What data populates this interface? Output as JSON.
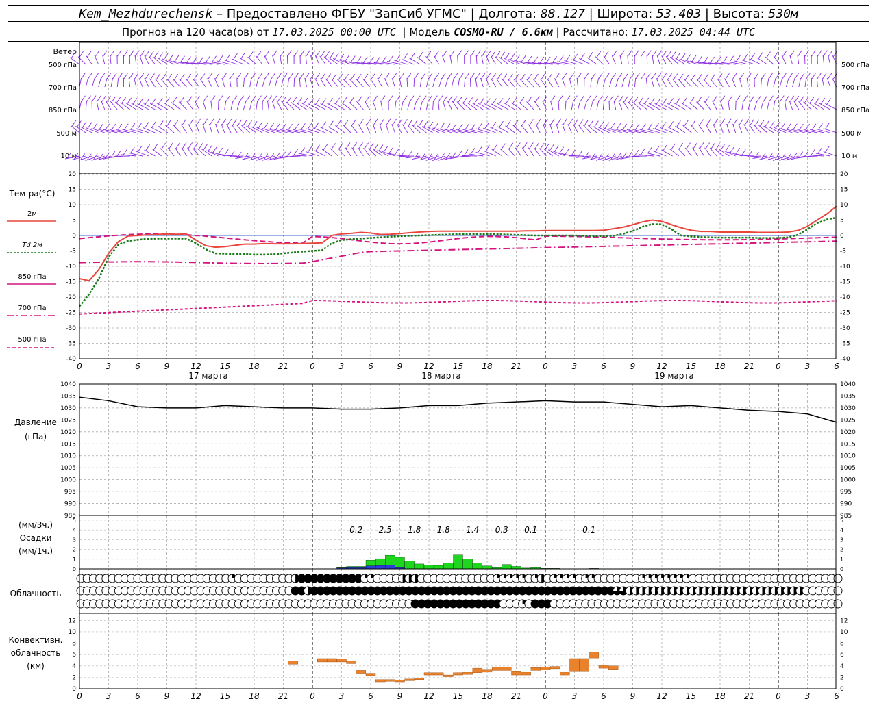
{
  "header": {
    "station": "Kem_Mezhdurechensk",
    "provided_by": "– Предоставлено ФГБУ \"ЗапСиб УГМС\"",
    "lon_label": "Долгота:",
    "lon_value": "88.127",
    "lat_label": "Широта:",
    "lat_value": "53.403",
    "alt_label": "Высота:",
    "alt_value": "530м",
    "forecast_label": "Прогноз на 120 часа(ов) от",
    "forecast_start": "17.03.2025 00:00 UTC",
    "model_label": "Модель",
    "model_value": "COSMO-RU / 6.6км",
    "calc_label": "Рассчитано:",
    "calc_value": "17.03.2025 04:44 UTC"
  },
  "labels": {
    "wind": "Ветер",
    "wind_levels": [
      "500 гПа",
      "700 гПа",
      "850 гПа",
      "500 м",
      "10  м"
    ],
    "temp_title": "Тем-ра(°C)",
    "legend_2m": "2м",
    "legend_td": "Td  2м",
    "legend_850": "850 гПа",
    "legend_700": "700 гПа",
    "legend_500": "500 гПа",
    "pressure_title": "Давление",
    "pressure_unit": "(гПа)",
    "precip_unit3": "(мм/3ч.)",
    "precip_title": "Осадки",
    "precip_unit1": "(мм/1ч.)",
    "cloud_title": "Облачность",
    "conv_title1": "Конвективн.",
    "conv_title2": "облачность",
    "conv_unit": "(км)",
    "days": [
      "17 марта",
      "18 марта",
      "19 марта"
    ]
  },
  "colors": {
    "wind": "#8b2be2",
    "t2m": "#e8463c",
    "td2m": "#1a7a1a",
    "t850": "#d4147f",
    "pressure": "#000000",
    "precip_rain": "#1fd61f",
    "precip_snow": "#2a3fd0",
    "convective": "#e8822c"
  },
  "chart_data": [
    {
      "type": "line",
      "title": "Тем-ра(°C)",
      "x_hours": [
        0,
        1,
        2,
        3,
        4,
        5,
        6,
        7,
        8,
        9,
        10,
        11,
        12,
        13,
        14,
        15,
        16,
        17,
        18,
        19,
        20,
        21,
        22,
        23,
        24,
        25,
        26,
        27,
        28,
        29,
        30,
        31,
        32,
        33,
        34,
        35,
        36,
        37,
        38,
        39,
        40,
        41,
        42,
        43,
        44,
        45,
        46,
        47,
        48,
        49,
        50,
        51,
        52,
        53,
        54,
        55,
        56,
        57,
        58,
        59,
        60,
        61,
        62,
        63,
        64,
        65,
        66,
        67,
        68,
        69,
        70,
        71,
        72,
        73,
        74,
        75,
        76,
        77,
        78
      ],
      "ylim": [
        -40,
        20
      ],
      "yticks": [
        -40,
        -35,
        -30,
        -25,
        -20,
        -15,
        -10,
        -5,
        0,
        5,
        10,
        15,
        20
      ],
      "series": [
        {
          "name": "2м",
          "values": [
            -14,
            -14.7,
            -11,
            -5.8,
            -2,
            -0.2,
            0,
            0.2,
            0.3,
            0.5,
            0.4,
            0.5,
            -1.5,
            -3.3,
            -3.8,
            -3.6,
            -3.2,
            -2.8,
            -2.8,
            -2.6,
            -2.7,
            -2.7,
            -2.7,
            -2.6,
            -2.5,
            -2.4,
            0,
            0.5,
            0.7,
            1,
            0.8,
            0.3,
            0.4,
            0.6,
            0.9,
            1.1,
            1.3,
            1.4,
            1.4,
            1.4,
            1.4,
            1.4,
            1.4,
            1.4,
            1.4,
            1.4,
            1.5,
            1.5,
            1.6,
            1.6,
            1.6,
            1.6,
            1.6,
            1.6,
            1.7,
            2.2,
            2.7,
            3.5,
            4.4,
            5,
            4.6,
            3.5,
            2.5,
            1.7,
            1.3,
            1.3,
            1.1,
            1.1,
            1.1,
            1.1,
            1,
            1,
            1,
            1.1,
            1.6,
            3,
            5,
            7,
            9.5
          ]
        },
        {
          "name": "Td 2м",
          "values": [
            -23,
            -19,
            -14,
            -7,
            -3,
            -1.8,
            -1.4,
            -1.1,
            -1,
            -1,
            -1,
            -1,
            -2.5,
            -4.5,
            -5.8,
            -5.9,
            -6,
            -6,
            -6.2,
            -6.2,
            -6.1,
            -5.8,
            -5.5,
            -5.2,
            -5,
            -4.8,
            -2.5,
            -1.5,
            -1.2,
            -1,
            -0.8,
            -0.6,
            -0.4,
            -0.2,
            -0.1,
            0,
            0.1,
            0.2,
            0.3,
            0.4,
            0.5,
            0.5,
            0.5,
            0.4,
            0.3,
            0.2,
            0.1,
            0,
            0,
            0,
            0,
            0,
            -0.1,
            -0.2,
            -0.2,
            -0.1,
            0.5,
            1.5,
            2.8,
            3.7,
            3.6,
            2,
            0,
            -0.3,
            -0.5,
            -0.6,
            -0.7,
            -0.7,
            -0.7,
            -0.7,
            -0.8,
            -0.8,
            -0.8,
            -0.6,
            0.2,
            2,
            4,
            5.2,
            5.8
          ]
        }
      ]
    },
    {
      "type": "line",
      "title": "Давление",
      "ylabel": "(гПа)",
      "ylim": [
        985,
        1040
      ],
      "yticks": [
        985,
        990,
        995,
        1000,
        1005,
        1010,
        1015,
        1020,
        1025,
        1030,
        1035,
        1040
      ],
      "x_hours": [
        0,
        3,
        6,
        9,
        12,
        15,
        18,
        21,
        24,
        27,
        30,
        33,
        36,
        39,
        42,
        45,
        48,
        51,
        54,
        57,
        60,
        63,
        66,
        69,
        72,
        75,
        78
      ],
      "series": [
        {
          "name": "",
          "values": [
            1034.5,
            1033,
            1030.5,
            1030,
            1030,
            1031,
            1030.5,
            1030,
            1030,
            1029.5,
            1029.5,
            1030,
            1031,
            1031,
            1032,
            1032.5,
            1033,
            1032.5,
            1032.5,
            1031.5,
            1030.5,
            1031,
            1030,
            1029,
            1028.5,
            1027.5,
            1024
          ]
        }
      ]
    },
    {
      "type": "bar",
      "title": "Осадки",
      "ylabel": "(мм/1ч.)",
      "ylim": [
        0,
        5
      ],
      "x_hours": [
        27,
        28,
        29,
        30,
        31,
        32,
        33,
        34,
        35,
        36,
        37,
        38,
        39,
        40,
        41,
        42,
        43,
        44,
        45,
        46,
        47,
        48,
        49,
        50,
        51,
        52,
        53,
        54
      ],
      "series": [
        {
          "name": "rain",
          "values": [
            0.05,
            0.05,
            0.05,
            0.6,
            0.7,
            1,
            1,
            0.8,
            0.5,
            0.4,
            0.35,
            0.6,
            1.5,
            1,
            0.6,
            0.3,
            0.2,
            0.45,
            0.25,
            0.15,
            0.2,
            0.05,
            0.05,
            0,
            0,
            0,
            0.05,
            0
          ]
        },
        {
          "name": "snow",
          "values": [
            0.15,
            0.2,
            0.2,
            0.3,
            0.35,
            0.4,
            0.2,
            0,
            0,
            0,
            0,
            0,
            0,
            0,
            0,
            0,
            0,
            0,
            0,
            0,
            0,
            0,
            0,
            0,
            0,
            0,
            0,
            0
          ]
        }
      ],
      "totals_3h": [
        "0.2",
        "2.5",
        "1.8",
        "1.8",
        "1.4",
        "0.3",
        "0.1",
        "",
        "0.1"
      ]
    },
    {
      "type": "bar",
      "title": "Конвективн. облачность",
      "ylabel": "(км)",
      "ylim": [
        0,
        13
      ],
      "yticks": [
        0,
        2,
        4,
        6,
        8,
        10,
        12
      ],
      "x_hours": [
        22,
        25,
        26,
        27,
        28,
        29,
        30,
        31,
        32,
        33,
        34,
        35,
        36,
        37,
        38,
        39,
        40,
        41,
        42,
        43,
        44,
        45,
        46,
        47,
        48,
        49,
        50,
        51,
        52,
        53,
        54,
        55
      ],
      "bases_km": [
        4.3,
        4.7,
        4.7,
        4.7,
        4.4,
        2.7,
        2.3,
        1.2,
        1.3,
        1.2,
        1.4,
        1.6,
        2.4,
        2.4,
        2.1,
        2.4,
        2.5,
        2.8,
        2.9,
        3.2,
        3.2,
        2.4,
        2.4,
        3.2,
        3.3,
        3.5,
        2.4,
        3.1,
        3.1,
        5.4,
        3.6,
        3.4
      ],
      "tops_km": [
        4.9,
        5.3,
        5.3,
        5.2,
        4.9,
        3.2,
        2.7,
        1.6,
        1.6,
        1.5,
        1.7,
        1.9,
        2.8,
        2.8,
        2.4,
        2.8,
        2.9,
        3.6,
        3.4,
        3.8,
        3.8,
        3.1,
        2.9,
        3.7,
        3.8,
        3.9,
        2.9,
        5.3,
        5.3,
        6.4,
        4.1,
        4
      ]
    }
  ],
  "cloud_rows": {
    "top": "0000000000000000000000001000000000244444444441100002220000000000001111101201111011000000011111111000000000000000000000000",
    "mid": "0000000000000000000000000000000000442444444444444444444444444444444444444444444444444332222222222222222222222222222000000",
    "low": "0000000000000000000000000000000000000000000000000000044444444444444000104440000000000000000000000000000000000000000000000"
  },
  "x_axis_ticks": [
    "0",
    "3",
    "6",
    "9",
    "12",
    "15",
    "18",
    "21",
    "0",
    "3",
    "6",
    "9",
    "12",
    "15",
    "18",
    "21",
    "0",
    "3",
    "6",
    "9",
    "12",
    "15",
    "18",
    "21",
    "0",
    "3",
    "6"
  ]
}
